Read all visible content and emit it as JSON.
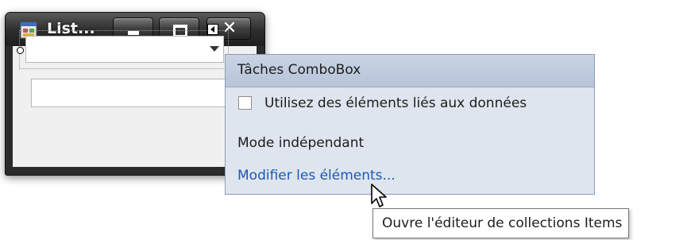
{
  "window": {
    "title": "List...",
    "icon": "form-app-icon",
    "controls": [
      "minimize-icon",
      "maximize-icon",
      "close-icon"
    ],
    "close_glyph": "✕"
  },
  "tasks_panel": {
    "title": "Tâches ComboBox",
    "checkbox_label": "Utilisez des éléments liés aux données",
    "checkbox_checked": false,
    "mode_text": "Mode indépendant",
    "link_text": "Modifier les éléments..."
  },
  "tooltip": {
    "text": "Ouvre l'éditeur de collections Items"
  },
  "colors": {
    "panel_background": "#dfe5ee",
    "panel_header": "#b6c4d9",
    "link": "#1a58b8",
    "titlebar": "#2c2c2c"
  }
}
